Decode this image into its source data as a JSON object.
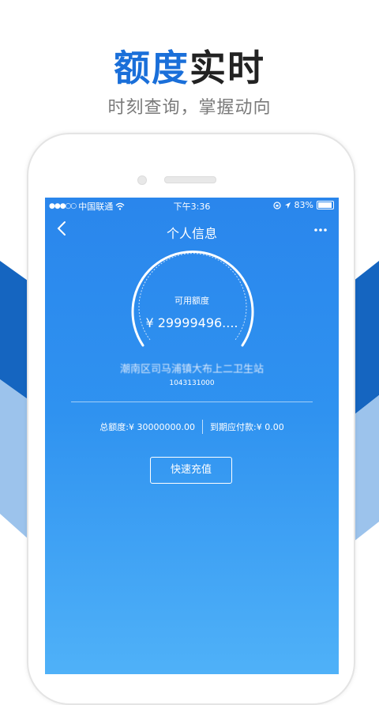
{
  "promo": {
    "title_blue": "额度",
    "title_dark": "实时",
    "subtitle": "时刻查询，掌握动向"
  },
  "colors": {
    "accent": "#1a6fd9",
    "screen_top": "#2a86ec",
    "screen_bottom": "#4fb1f8",
    "bg_shape_dark": "#1565c0",
    "bg_shape_light": "#9cc3ec"
  },
  "statusbar": {
    "signal_dots": "●●●○○",
    "carrier": "中国联通",
    "wifi_icon": "wifi-icon",
    "time": "下午3:36",
    "battery_text": "83%",
    "battery_level": 0.83
  },
  "navbar": {
    "back_icon": "chevron-left-icon",
    "title": "个人信息",
    "more_icon": "more-icon",
    "back_glyph": "‹",
    "more_glyph": "···"
  },
  "credit": {
    "label": "可用额度",
    "value": "¥ 29999496....",
    "station": "潮南区司马浦镇大布上二卫生站",
    "account": "1043131000"
  },
  "totals": {
    "total_label": "总额度:",
    "total_value": "¥ 30000000.00",
    "due_label": "到期应付款:",
    "due_value": "¥ 0.00"
  },
  "actions": {
    "recharge_label": "快速充值"
  }
}
